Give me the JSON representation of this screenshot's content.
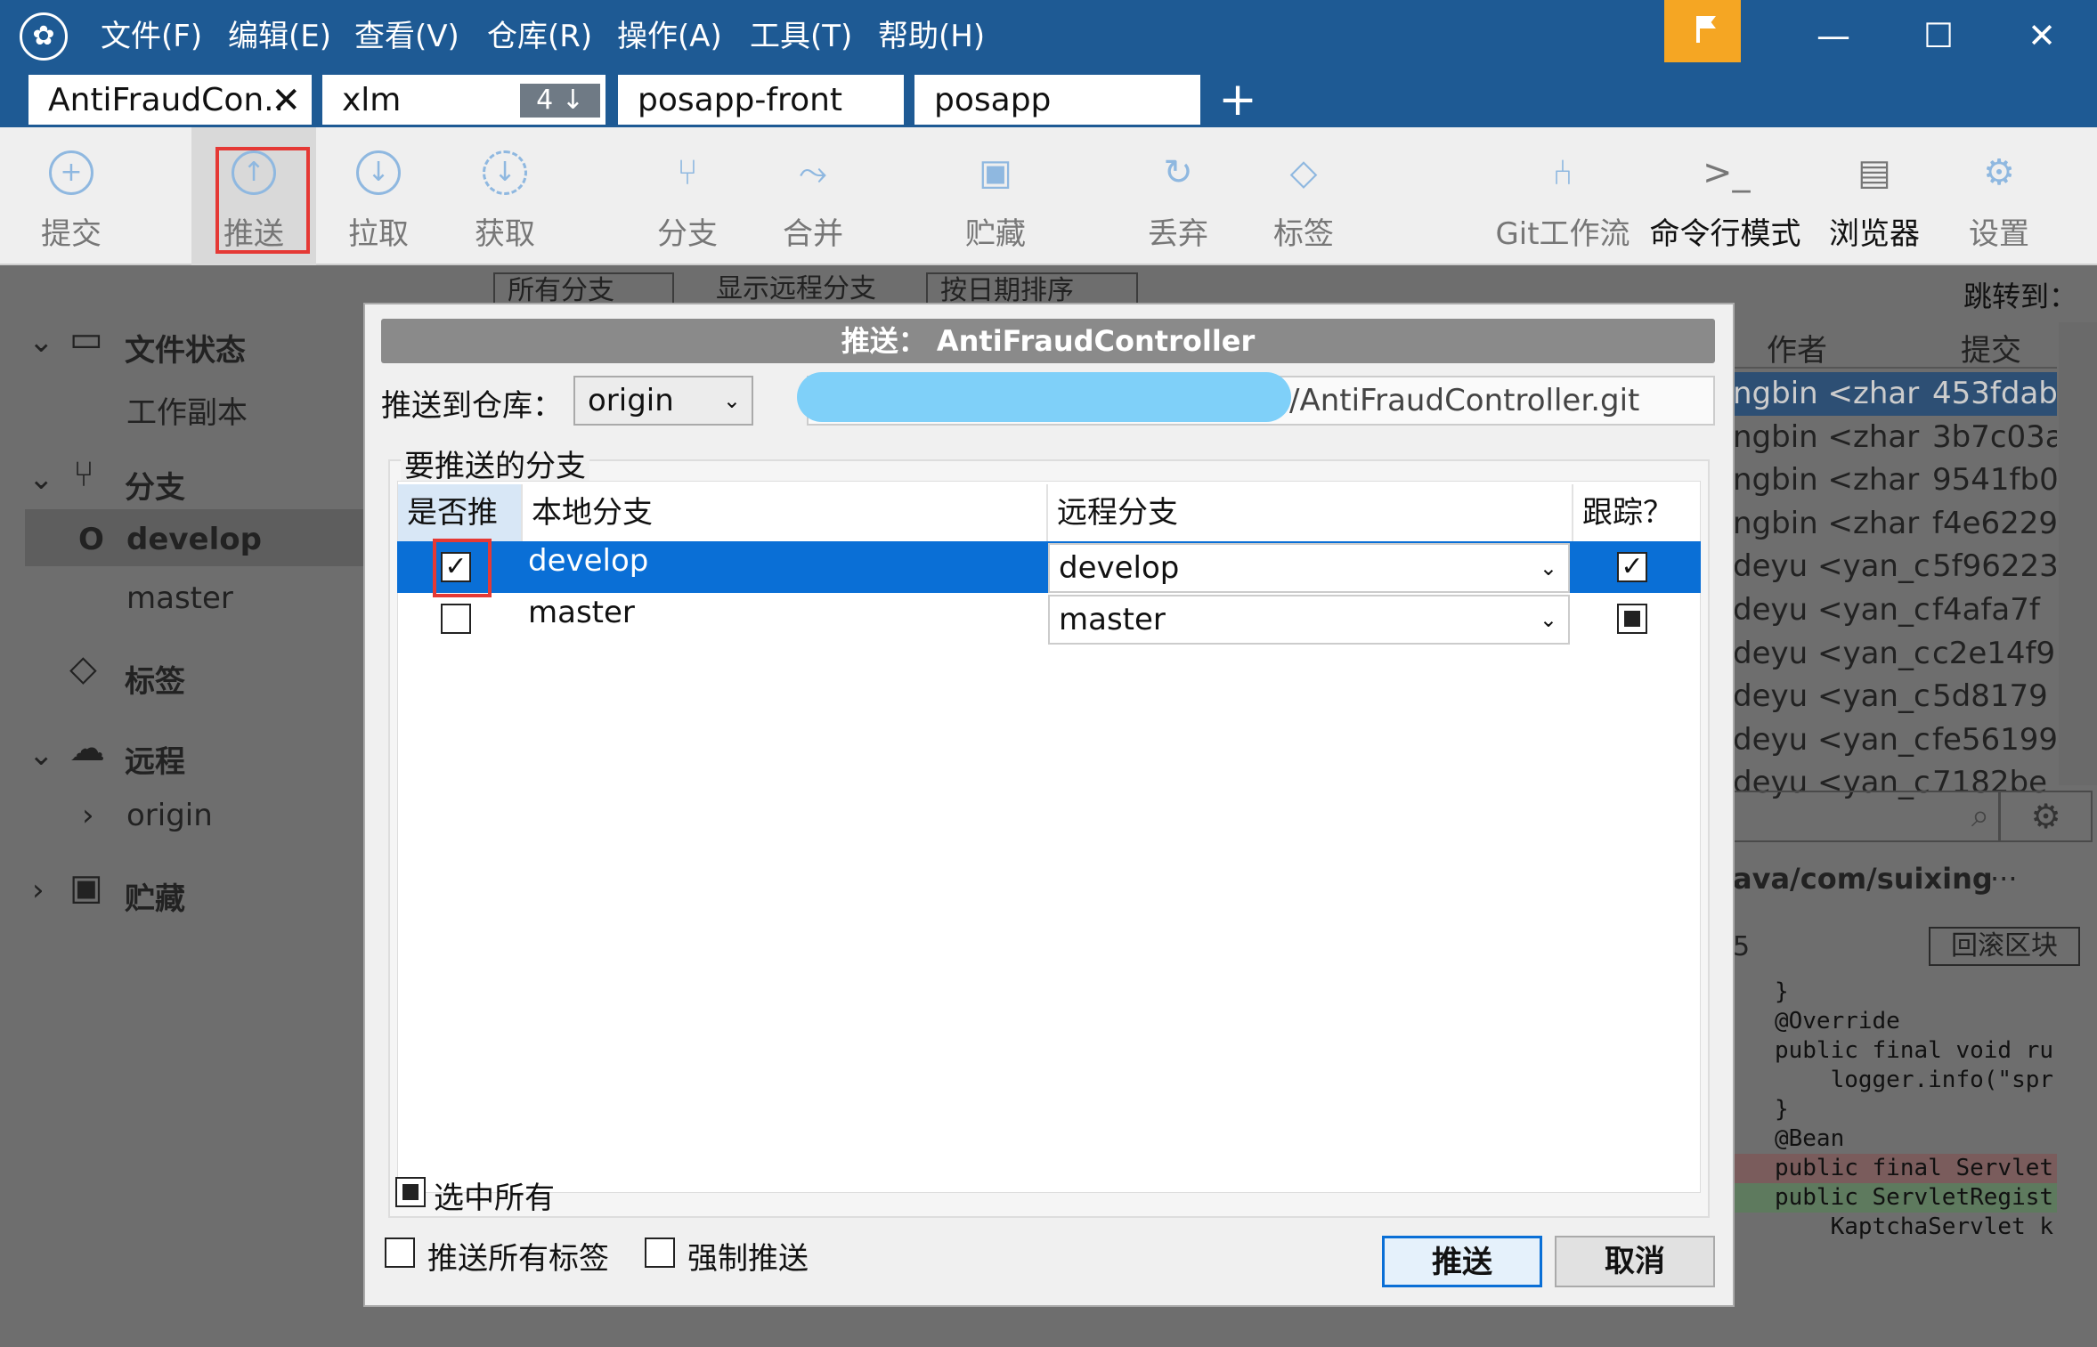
{
  "menu": [
    "文件(F)",
    "编辑(E)",
    "查看(V)",
    "仓库(R)",
    "操作(A)",
    "工具(T)",
    "帮助(H)"
  ],
  "window_controls": {
    "minimize": "—",
    "maximize": "☐",
    "close": "✕"
  },
  "tabs": [
    {
      "label": "AntiFraudCon..",
      "close": "✕"
    },
    {
      "label": "xlm",
      "badge": "4 ↓"
    },
    {
      "label": "posapp-front"
    },
    {
      "label": "posapp"
    }
  ],
  "tab_add": "+",
  "toolbar": {
    "commit": "提交",
    "push": "推送",
    "pull": "拉取",
    "fetch": "获取",
    "branch": "分支",
    "merge": "合并",
    "stash": "贮藏",
    "discard": "丢弃",
    "tag": "标签",
    "gitflow": "Git工作流",
    "terminal": "命令行模式",
    "explorer": "浏览器",
    "settings": "设置"
  },
  "sidebar": {
    "file_status": "文件状态",
    "working_copy": "工作副本",
    "branches": "分支",
    "branch_items": [
      "develop",
      "master"
    ],
    "current_marker": "O",
    "tags": "标签",
    "remotes": "远程",
    "remote_items": [
      "origin"
    ],
    "stashes": "贮藏"
  },
  "filterbar": {
    "all_branches": "所有分支",
    "show_remote": "显示远程分支",
    "sort": "按日期排序",
    "jump_to": "跳转到："
  },
  "commit_list": {
    "headers": [
      "作者",
      "提交"
    ],
    "rows": [
      [
        "ngbin <zhar",
        "453fdab"
      ],
      [
        "ngbin <zhar",
        "3b7c03a"
      ],
      [
        "ngbin <zhar",
        "9541fb0"
      ],
      [
        "ngbin <zhar",
        "f4e6229"
      ],
      [
        "deyu <yan_c",
        "5f96223"
      ],
      [
        "deyu <yan_c",
        "f4afa7f"
      ],
      [
        "deyu <yan_c",
        "c2e14f9"
      ],
      [
        "deyu <yan_c",
        "5d8179"
      ],
      [
        "deyu <yan_c",
        "fe56199"
      ],
      [
        "deyu <yan_c",
        "7182be"
      ]
    ]
  },
  "diff": {
    "path": "ava/com/suixing",
    "more": "···",
    "hunk_no": "5",
    "revert_hunk": "回滚区块",
    "lines": [
      {
        "text": "   }",
        "kind": "ctx"
      },
      {
        "text": "   @Override",
        "kind": "ctx"
      },
      {
        "text": "   public final void ru",
        "kind": "ctx"
      },
      {
        "text": "       logger.info(\"spr",
        "kind": "ctx"
      },
      {
        "text": "   }",
        "kind": "ctx"
      },
      {
        "text": "   @Bean",
        "kind": "ctx"
      },
      {
        "text": "   public final Servlet",
        "kind": "del"
      },
      {
        "text": "   public ServletRegist",
        "kind": "add"
      },
      {
        "text": "       KaptchaServlet k",
        "kind": "ctx"
      }
    ]
  },
  "dialog": {
    "title": "推送： AntiFraudController",
    "repo_label": "推送到仓库：",
    "repo_value": "origin",
    "url_visible": "/AntiFraudController.git",
    "branches_group": "要推送的分支",
    "columns": [
      "是否推",
      "本地分支",
      "远程分支",
      "跟踪？"
    ],
    "rows": [
      {
        "push": true,
        "local": "develop",
        "remote": "develop",
        "track": true
      },
      {
        "push": false,
        "local": "master",
        "remote": "master",
        "track": "partial"
      }
    ],
    "select_all": "选中所有",
    "push_all_tags": "推送所有标签",
    "force_push": "强制推送",
    "push_button": "推送",
    "cancel_button": "取消"
  }
}
